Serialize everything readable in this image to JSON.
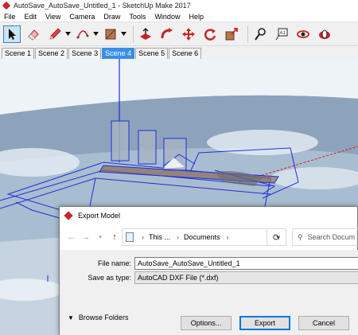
{
  "window": {
    "title": "AutoSave_AutoSave_Untitled_1 - SketchUp Make 2017"
  },
  "menu": [
    "File",
    "Edit",
    "View",
    "Camera",
    "Draw",
    "Tools",
    "Window",
    "Help"
  ],
  "toolbar": {
    "tools": [
      "select",
      "eraser",
      "pencil",
      "arc",
      "paint-bucket",
      "push-pull",
      "follow-me",
      "move",
      "rotate",
      "scale",
      "tape-measure",
      "text",
      "orbit",
      "look-around"
    ]
  },
  "scenes": {
    "tabs": [
      "Scene 1",
      "Scene 2",
      "Scene 3",
      "Scene 4",
      "Scene 5",
      "Scene 6"
    ],
    "active": "Scene 4"
  },
  "dialog": {
    "title": "Export Model",
    "address": {
      "crumb1": "This ...",
      "crumb2": "Documents"
    },
    "search_placeholder": "Search Docum",
    "file_name_label": "File name:",
    "file_name_value": "AutoSave_AutoSave_Untitled_1",
    "save_type_label": "Save as type:",
    "save_type_value": "AutoCAD DXF File (*.dxf)",
    "browse_folders": "Browse Folders",
    "buttons": {
      "options": "Options...",
      "export": "Export",
      "cancel": "Cancel"
    }
  }
}
